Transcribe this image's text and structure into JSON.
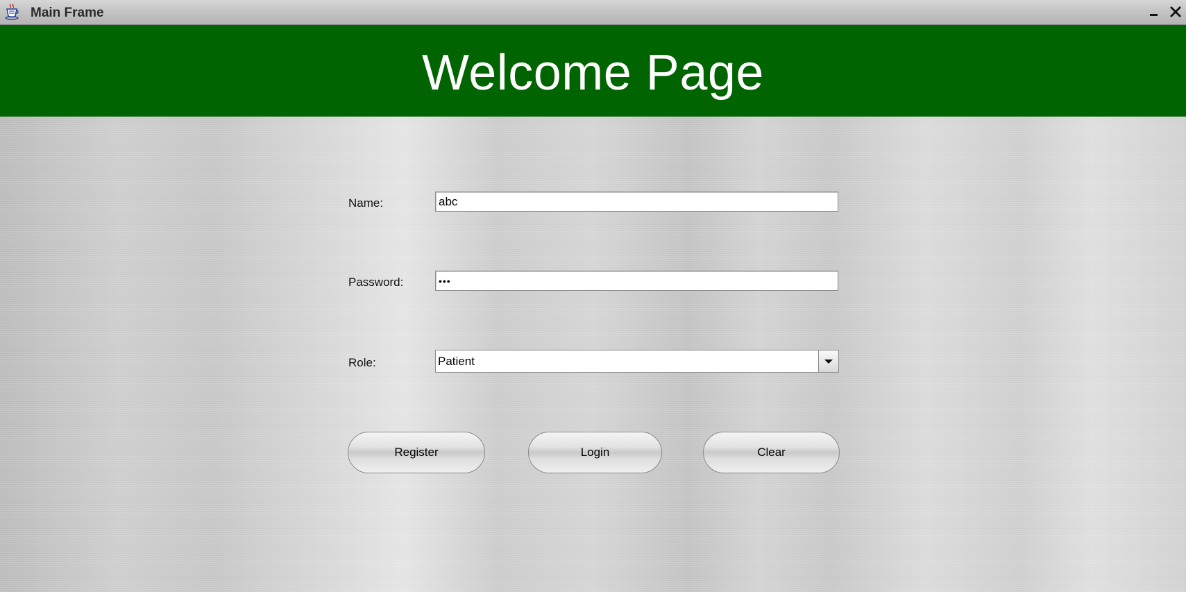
{
  "window": {
    "title": "Main Frame",
    "app_icon": "java-cup-icon",
    "controls": {
      "minimize": "minimize-icon",
      "close": "close-icon"
    }
  },
  "header": {
    "title": "Welcome Page",
    "background_color": "#006400"
  },
  "form": {
    "name_label": "Name:",
    "name_value": "abc",
    "password_label": "Password:",
    "password_masked": "•••",
    "role_label": "Role:",
    "role_selected": "Patient"
  },
  "buttons": {
    "register": "Register",
    "login": "Login",
    "clear": "Clear"
  }
}
